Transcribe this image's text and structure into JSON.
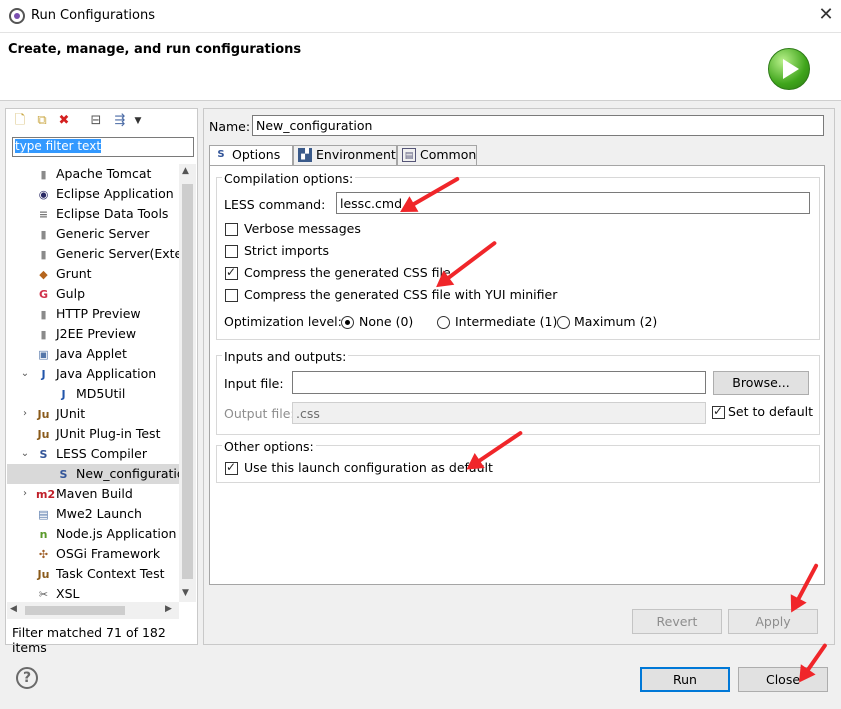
{
  "window": {
    "title": "Run Configurations",
    "close": "✕"
  },
  "banner": {
    "title": "Create, manage, and run configurations"
  },
  "left": {
    "filter_text": "type filter text",
    "status": "Filter matched 71 of 182 items",
    "tree": [
      {
        "label": "Apache Tomcat",
        "icon": "server-icon",
        "glyph": "▮",
        "color": "#8a8a8a",
        "twisty": ""
      },
      {
        "label": "Eclipse Application",
        "icon": "eclipse-icon",
        "glyph": "◉",
        "color": "#2c2c66",
        "twisty": ""
      },
      {
        "label": "Eclipse Data Tools",
        "icon": "database-icon",
        "glyph": "≡",
        "color": "#777",
        "twisty": ""
      },
      {
        "label": "Generic Server",
        "icon": "server-icon",
        "glyph": "▮",
        "color": "#8a8a8a",
        "twisty": ""
      },
      {
        "label": "Generic Server(Extern",
        "icon": "server-icon",
        "glyph": "▮",
        "color": "#8a8a8a",
        "twisty": ""
      },
      {
        "label": "Grunt",
        "icon": "grunt-icon",
        "glyph": "◆",
        "color": "#b5651d",
        "twisty": ""
      },
      {
        "label": "Gulp",
        "icon": "gulp-icon",
        "glyph": "G",
        "color": "#d0314a",
        "twisty": ""
      },
      {
        "label": "HTTP Preview",
        "icon": "server-icon",
        "glyph": "▮",
        "color": "#8a8a8a",
        "twisty": ""
      },
      {
        "label": "J2EE Preview",
        "icon": "server-icon",
        "glyph": "▮",
        "color": "#8a8a8a",
        "twisty": ""
      },
      {
        "label": "Java Applet",
        "icon": "applet-icon",
        "glyph": "▣",
        "color": "#5577aa",
        "twisty": ""
      },
      {
        "label": "Java Application",
        "icon": "java-app-icon",
        "glyph": "J",
        "color": "#2255aa",
        "twisty": "⌄"
      },
      {
        "label": "MD5Util",
        "icon": "java-app-icon",
        "glyph": "J",
        "color": "#2255aa",
        "twisty": "",
        "child": true
      },
      {
        "label": "JUnit",
        "icon": "junit-icon",
        "glyph": "Ju",
        "color": "#8a5a1a",
        "twisty": "›"
      },
      {
        "label": "JUnit Plug-in Test",
        "icon": "junit-icon",
        "glyph": "Ju",
        "color": "#8a5a1a",
        "twisty": ""
      },
      {
        "label": "LESS Compiler",
        "icon": "less-icon",
        "glyph": "S",
        "color": "#335599",
        "twisty": "⌄"
      },
      {
        "label": "New_configuration",
        "icon": "less-icon",
        "glyph": "S",
        "color": "#335599",
        "twisty": "",
        "child": true,
        "selected": true
      },
      {
        "label": "Maven Build",
        "icon": "maven-icon",
        "glyph": "m2",
        "color": "#c0202a",
        "twisty": "›"
      },
      {
        "label": "Mwe2 Launch",
        "icon": "mwe2-icon",
        "glyph": "▤",
        "color": "#5577aa",
        "twisty": ""
      },
      {
        "label": "Node.js Application",
        "icon": "nodejs-icon",
        "glyph": "n",
        "color": "#5a9a2a",
        "twisty": ""
      },
      {
        "label": "OSGi Framework",
        "icon": "osgi-icon",
        "glyph": "✣",
        "color": "#a0602a",
        "twisty": ""
      },
      {
        "label": "Task Context Test",
        "icon": "junit-icon",
        "glyph": "Ju",
        "color": "#8a5a1a",
        "twisty": ""
      },
      {
        "label": "XSL",
        "icon": "xsl-icon",
        "glyph": "✂",
        "color": "#555",
        "twisty": ""
      }
    ]
  },
  "right": {
    "name_label": "Name:",
    "name_value": "New_configuration",
    "tabs": [
      "Options",
      "Environment",
      "Common"
    ],
    "compilation": {
      "group_label": "Compilation options:",
      "less_label": "LESS command:",
      "less_value": "lessc.cmd",
      "verbose": "Verbose messages",
      "strict": "Strict imports",
      "compress": "Compress the generated CSS file",
      "compress_yui": "Compress the generated CSS file with YUI minifier",
      "opt_label": "Optimization level:",
      "opt_none": "None (0)",
      "opt_inter": "Intermediate (1)",
      "opt_max": "Maximum (2)"
    },
    "io": {
      "group_label": "Inputs and outputs:",
      "input_label": "Input file:",
      "input_value": "",
      "browse": "Browse...",
      "output_label": "Output file:",
      "output_value": ".css",
      "set_default": "Set to default"
    },
    "other": {
      "group_label": "Other options:",
      "use_default": "Use this launch configuration as default"
    },
    "revert": "Revert",
    "apply": "Apply"
  },
  "footer": {
    "help": "?",
    "run": "Run",
    "close": "Close"
  },
  "colors": {
    "accent": "#0078d7",
    "annotation": "#f0262a",
    "selection": "#3399ff"
  }
}
